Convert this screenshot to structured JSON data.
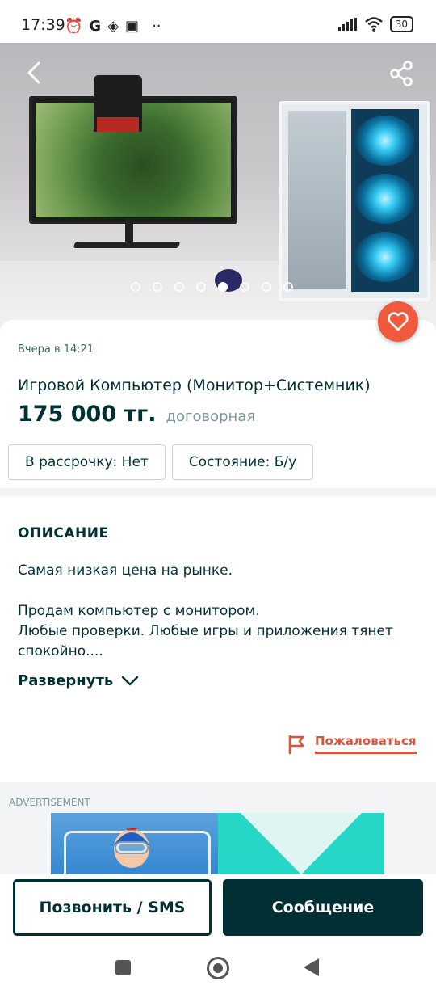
{
  "status_bar": {
    "time": "17:39",
    "left_icons": [
      "alarm-icon",
      "google-icon",
      "app-icon",
      "app-icon-2",
      "more-dots-icon"
    ],
    "battery": "30"
  },
  "hero": {
    "image_alt": "",
    "page_count": 8,
    "active_index": 4
  },
  "listing": {
    "date": "Вчера в 14:21",
    "title": "Игровой Компьютер (Монитор+Системник)",
    "price": "175 000 тг.",
    "price_note": "договорная",
    "params": [
      "В рассрочку: Нет",
      "Состояние: Б/у"
    ]
  },
  "description": {
    "heading": "ОПИСАНИЕ",
    "lines": [
      "Самая низкая цена на рынке.",
      "Продам компьютер с монитором.",
      "Любые проверки. Любые игры и приложения тянет спокойно...."
    ],
    "expand_label": "Развернуть",
    "report_label": "Пожаловаться"
  },
  "ad": {
    "label": "ADVERTISEMENT"
  },
  "actions": {
    "call_label": "Позвонить / SMS",
    "message_label": "Сообщение"
  },
  "colors": {
    "primary": "#002f34",
    "accent": "#f05a3c",
    "report": "#d9543c"
  }
}
